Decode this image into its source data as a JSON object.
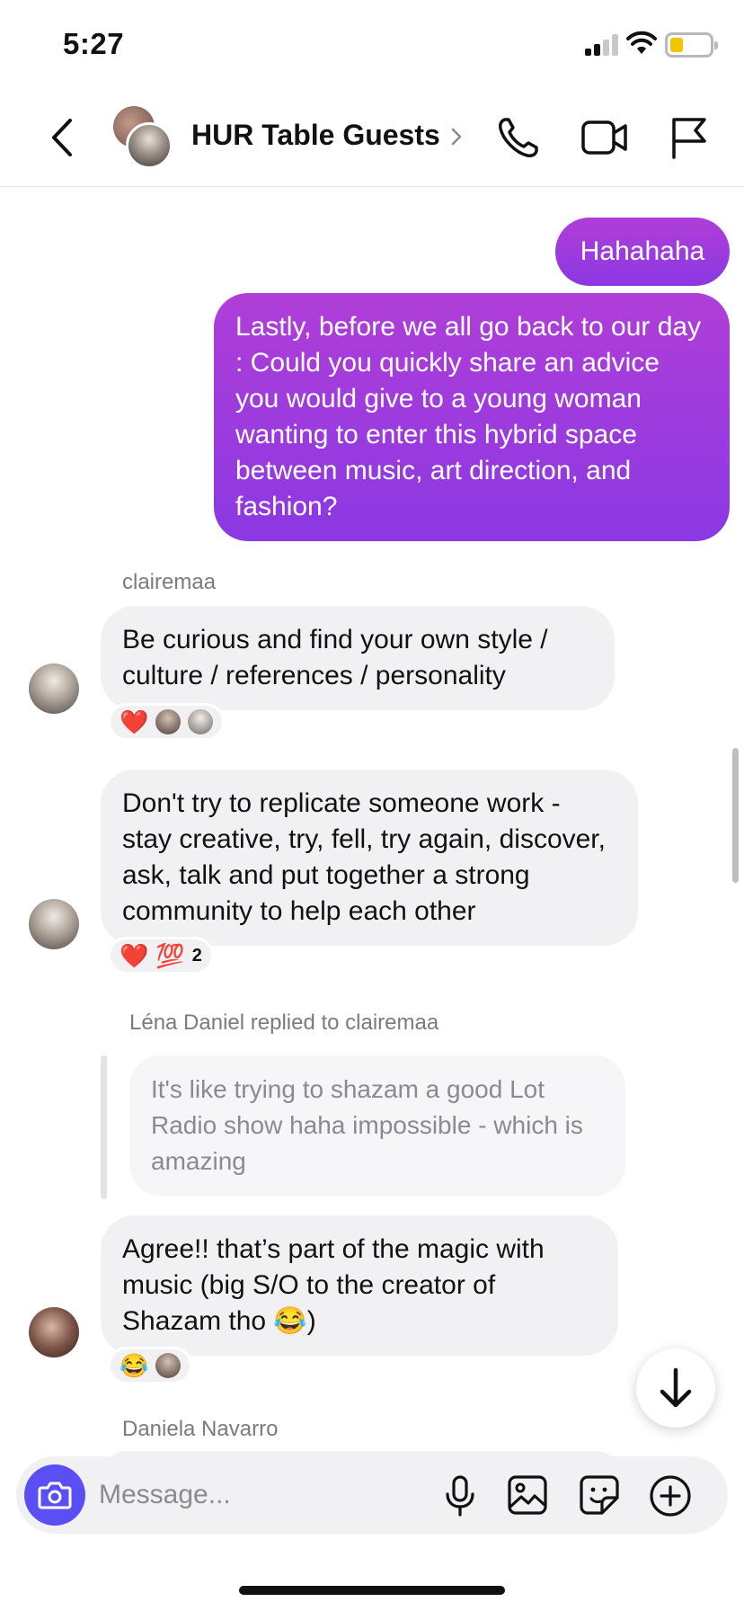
{
  "status_bar": {
    "time": "5:27"
  },
  "header": {
    "title": "HUR Table Guests",
    "icons": [
      "back-icon",
      "chevron-right-icon",
      "phone-icon",
      "video-camera-icon",
      "flag-icon"
    ]
  },
  "messages": {
    "out_1": "Hahahaha",
    "out_2": "Lastly, before we all go back to our day : Could you quickly share an advice you would give to a young woman wanting to enter this hybrid space between music, art direction, and fashion?",
    "sender_1": "clairemaa",
    "in_1": "Be curious and find your own style / culture / references / personality",
    "in_1_reactions": {
      "emoji": "❤️"
    },
    "in_2": "Don't try to replicate someone work - stay creative, try, fell, try again, discover, ask, talk and put together a strong community to help each other",
    "in_2_reactions": {
      "emoji_1": "❤️",
      "emoji_2": "💯",
      "count": "2"
    },
    "reply_label": "Léna Daniel replied to clairemaa",
    "reply_quote": "It's like trying to shazam a good Lot Radio show haha impossible - which is amazing",
    "in_3": "Agree!! that’s part of the magic with music (big S/O to the creator of Shazam tho 😂)",
    "in_3_reactions": {
      "emoji": "😂"
    },
    "sender_2": "Daniela Navarro"
  },
  "composer": {
    "placeholder": "Message...",
    "icons": [
      "camera-icon",
      "microphone-icon",
      "gallery-icon",
      "sticker-icon",
      "plus-circle-icon"
    ]
  },
  "colors": {
    "outgoing_bubble_top": "#b03ed8",
    "outgoing_bubble_bottom": "#8b38e3",
    "incoming_bubble": "#f1f1f3",
    "camera_button": "#5a4ff2"
  }
}
